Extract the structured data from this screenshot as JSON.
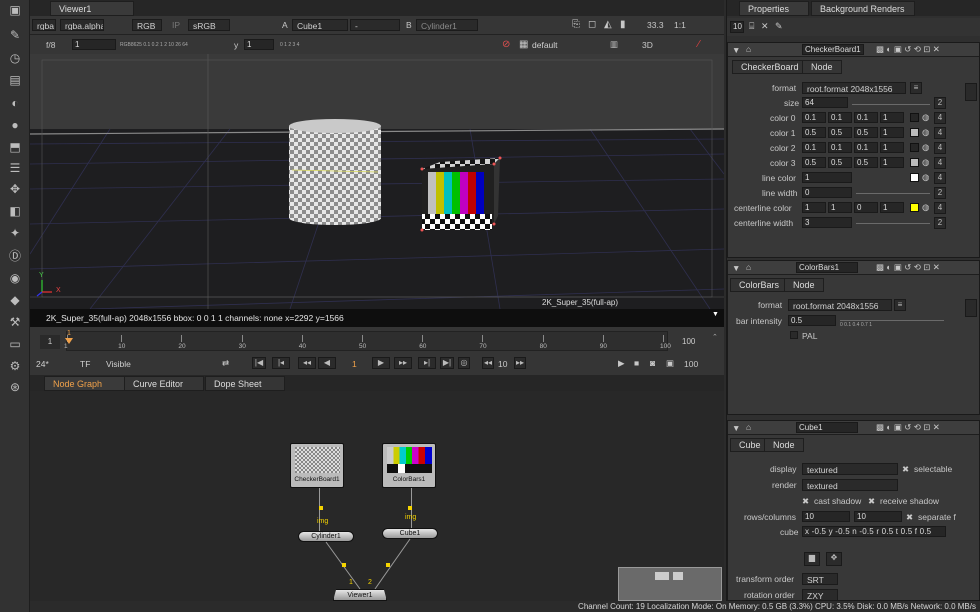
{
  "viewer": {
    "tab": "Viewer1",
    "row1": {
      "channels": "rgba",
      "alpha": "rgba.alpha",
      "display": "RGB",
      "ip": "IP",
      "colorspace": "sRGB",
      "a_label": "A",
      "a_input": "Cube1",
      "comp_op": "-",
      "b_label": "B",
      "b_input": "Cylinder1",
      "zoom": "33.3",
      "ratio": "1:1"
    },
    "row2": {
      "fstop": "f/8",
      "frame_value": "1",
      "y_label": "y",
      "gamma_value": "1",
      "proxy": "default",
      "view_mode": "3D"
    },
    "gain_ticks": "RGB8625 0.1 0.2   1   2    10  26  64",
    "gamma_ticks": "0        1        2        3        4",
    "format_label": "2K_Super_35(full-ap)",
    "status": "2K_Super_35(full-ap) 2048x1556  bbox: 0 0 1 1 channels: none  x=2292 y=1566",
    "axis_x": "X",
    "axis_y": "Y"
  },
  "timeline": {
    "start": "1",
    "end": "100",
    "ticks": [
      "1",
      "10",
      "20",
      "30",
      "40",
      "50",
      "60",
      "70",
      "80",
      "90",
      "100"
    ],
    "marker": "1",
    "fps": "24*",
    "tf": "TF",
    "visible": "Visible",
    "current_frame": "1",
    "step": "10",
    "end_frame": "100"
  },
  "tabs": {
    "node_graph": "Node Graph",
    "curve_editor": "Curve Editor",
    "dope_sheet": "Dope Sheet"
  },
  "nodegraph": {
    "checkerboard": "CheckerBoard1",
    "colorbars": "ColorBars1",
    "cylinder": "Cylinder1",
    "cube": "Cube1",
    "viewer": "Viewer1",
    "img1": "img",
    "img2": "img",
    "in1": "1",
    "in2": "2"
  },
  "statusbar": "Channel Count: 19  Localization Mode: On  Memory: 0.5 GB (3.3%)  CPU: 3.5%  Disk: 0.0 MB/s  Network: 0.0 MB/s",
  "right": {
    "tab_properties": "Properties",
    "tab_background": "Background Renders",
    "max_panels": "10",
    "checker": {
      "name": "CheckerBoard1",
      "tab1": "CheckerBoard",
      "tab2": "Node",
      "format_label": "format",
      "format_value": "root.format 2048x1556",
      "size_label": "size",
      "size_value": "64",
      "size_ch": "2",
      "colors": [
        {
          "label": "color 0",
          "v": [
            "0.1",
            "0.1",
            "0.1",
            "1"
          ],
          "sw": "#262626"
        },
        {
          "label": "color 1",
          "v": [
            "0.5",
            "0.5",
            "0.5",
            "1"
          ],
          "sw": "#bcbcbc"
        },
        {
          "label": "color 2",
          "v": [
            "0.1",
            "0.1",
            "0.1",
            "1"
          ],
          "sw": "#262626"
        },
        {
          "label": "color 3",
          "v": [
            "0.5",
            "0.5",
            "0.5",
            "1"
          ],
          "sw": "#bcbcbc"
        }
      ],
      "ch4": "4",
      "line_color_label": "line color",
      "line_color_value": "1",
      "line_width_label": "line width",
      "line_width_value": "0",
      "line_width_ch": "2",
      "cl_color_label": "centerline color",
      "cl_color_v": [
        "1",
        "1",
        "0",
        "1"
      ],
      "cl_swatch": "#ffff00",
      "cl_width_label": "centerline width",
      "cl_width_value": "3",
      "cl_width_ch": "2"
    },
    "colorbars": {
      "name": "ColorBars1",
      "tab1": "ColorBars",
      "tab2": "Node",
      "format_label": "format",
      "format_value": "root.format 2048x1556",
      "intensity_label": "bar intensity",
      "intensity_value": "0.5",
      "ticks": "0        0.1       0.4    0.7   1",
      "pal": "PAL"
    },
    "cube": {
      "name": "Cube1",
      "tab1": "Cube",
      "tab2": "Node",
      "display_label": "display",
      "display_value": "textured",
      "selectable": "selectable",
      "render_label": "render",
      "render_value": "textured",
      "cast_shadow": "cast shadow",
      "receive_shadow": "receive shadow",
      "rows_label": "rows/columns",
      "rows_value": "10",
      "cols_value": "10",
      "separate": "separate f",
      "cube_label": "cube",
      "cube_values": "x -0.5 y -0.5 n -0.5 r 0.5  t 0.5  f 0.5",
      "transform_order_label": "transform order",
      "transform_order_value": "SRT",
      "rotation_order_label": "rotation order",
      "rotation_order_value": "ZXY"
    }
  },
  "colors": {
    "accent": "#f0a14a",
    "selection": "#f5d400"
  }
}
